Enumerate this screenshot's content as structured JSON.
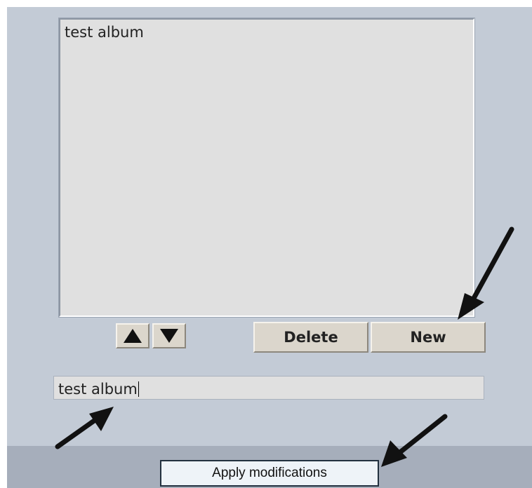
{
  "album_list": {
    "items": [
      {
        "label": "test album"
      }
    ]
  },
  "controls": {
    "move_up_icon": "triangle-up",
    "move_down_icon": "triangle-down",
    "delete_label": "Delete",
    "new_label": "New"
  },
  "name_input": {
    "value": "test album"
  },
  "footer": {
    "apply_label": "Apply modifications"
  },
  "colors": {
    "panel": "#c3cbd6",
    "footer_bar": "#a6aebb",
    "button_face": "#dbd6cc",
    "input_bg": "#e0e0e0",
    "annotation_arrow": "#111111"
  }
}
